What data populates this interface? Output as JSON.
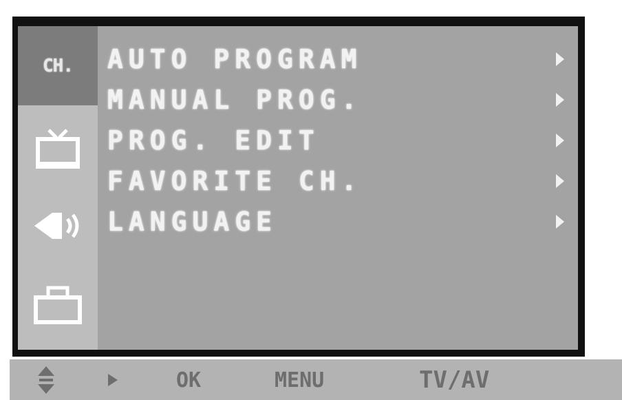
{
  "osd": {
    "sidebar": {
      "active_tab_label": "CH.",
      "tabs": [
        {
          "icon": "tv-icon"
        },
        {
          "icon": "speaker-icon"
        },
        {
          "icon": "briefcase-icon"
        }
      ]
    },
    "menu_items": [
      {
        "label": "AUTO PROGRAM",
        "arrow": "▶"
      },
      {
        "label": "MANUAL PROG.",
        "arrow": "▶"
      },
      {
        "label": "PROG. EDIT",
        "arrow": "▶"
      },
      {
        "label": "FAVORITE CH.",
        "arrow": "▶"
      },
      {
        "label": "LANGUAGE",
        "arrow": "▶"
      }
    ]
  },
  "hint_bar": {
    "ok_label": "OK",
    "menu_label": "MENU",
    "tvav_label": "TV/AV"
  },
  "colors": {
    "osd_background": "#a3a3a3",
    "sidebar_background": "#bdbdbd",
    "active_tab_background": "#7c7c7c",
    "frame": "#111111",
    "text": "#f2f2f2",
    "hint_text": "#6e6e6e"
  }
}
